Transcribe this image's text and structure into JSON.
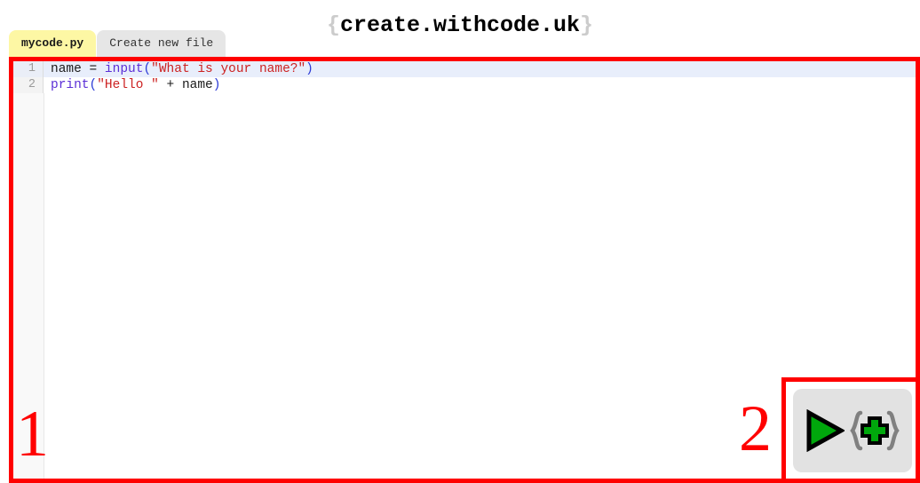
{
  "header": {
    "brace_open": "{",
    "site_name": "create.withcode.uk",
    "brace_close": "}"
  },
  "tabs": [
    {
      "label": "mycode.py",
      "active": true
    },
    {
      "label": "Create new file",
      "active": false
    }
  ],
  "editor": {
    "lines": [
      {
        "number": "1",
        "current": true,
        "tokens": [
          {
            "text": "name",
            "type": "plain"
          },
          {
            "text": " ",
            "type": "plain"
          },
          {
            "text": "=",
            "type": "op"
          },
          {
            "text": " ",
            "type": "plain"
          },
          {
            "text": "input",
            "type": "func"
          },
          {
            "text": "(",
            "type": "paren"
          },
          {
            "text": "\"What is your name?\"",
            "type": "string"
          },
          {
            "text": ")",
            "type": "paren"
          }
        ],
        "plain_text": "name = input(\"What is your name?\")"
      },
      {
        "number": "2",
        "current": false,
        "tokens": [
          {
            "text": "print",
            "type": "func"
          },
          {
            "text": "(",
            "type": "paren"
          },
          {
            "text": "\"Hello \"",
            "type": "string"
          },
          {
            "text": " ",
            "type": "plain"
          },
          {
            "text": "+",
            "type": "op"
          },
          {
            "text": " ",
            "type": "plain"
          },
          {
            "text": "name",
            "type": "plain"
          },
          {
            "text": ")",
            "type": "paren"
          }
        ],
        "plain_text": "print(\"Hello \" + name)"
      }
    ]
  },
  "annotations": [
    {
      "label": "1",
      "target": "code-editor"
    },
    {
      "label": "2",
      "target": "run-button"
    }
  ],
  "run_button": {
    "icon_play": "play-triangle-icon",
    "icon_braces_plus": "curly-braces-plus-icon"
  },
  "colors": {
    "annotation_red": "#ff0000",
    "active_tab": "#fdf7a4",
    "inactive_tab": "#e6e6e6",
    "current_line": "#e8eefb",
    "play_green": "#00a80c",
    "brace_gray": "#888888",
    "run_button_bg": "#e2e2e2",
    "string_red": "#cc2222",
    "function_purple": "#5b2fd6",
    "paren_blue": "#2b3ad6"
  }
}
